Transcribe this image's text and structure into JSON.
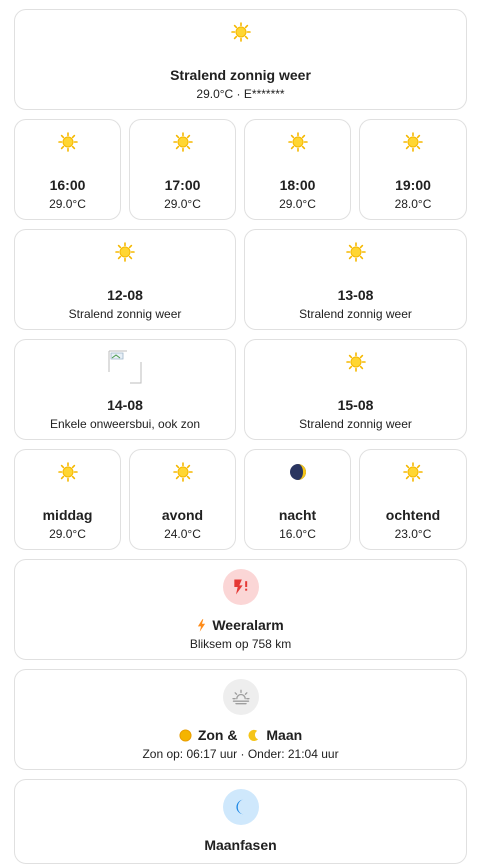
{
  "colors": {
    "sun": "#f5b800",
    "sun_center": "#ffd633",
    "alarm_bg": "#fbd6d6",
    "alarm_fg": "#e53935",
    "sunmoon_bg": "#eeeeee",
    "sunmoon_fg": "#9e9e9e",
    "moon_bg": "#cfe8fc",
    "moon_fg": "#1e88e5"
  },
  "current": {
    "icon": "sun-icon",
    "condition": "Stralend zonnig weer",
    "details": "29.0°C · E*******"
  },
  "hourly": [
    {
      "time": "16:00",
      "temp": "29.0°C",
      "icon": "sun-icon"
    },
    {
      "time": "17:00",
      "temp": "29.0°C",
      "icon": "sun-icon"
    },
    {
      "time": "18:00",
      "temp": "29.0°C",
      "icon": "sun-icon"
    },
    {
      "time": "19:00",
      "temp": "28.0°C",
      "icon": "sun-icon"
    }
  ],
  "daily": [
    {
      "date": "12-08",
      "condition": "Stralend zonnig weer",
      "icon": "sun-icon"
    },
    {
      "date": "13-08",
      "condition": "Stralend zonnig weer",
      "icon": "sun-icon"
    },
    {
      "date": "14-08",
      "condition": "Enkele onweersbui, ook zon",
      "icon": "broken-image-icon"
    },
    {
      "date": "15-08",
      "condition": "Stralend zonnig weer",
      "icon": "sun-icon"
    }
  ],
  "dayparts": [
    {
      "name": "middag",
      "temp": "29.0°C",
      "icon": "sun-icon"
    },
    {
      "name": "avond",
      "temp": "24.0°C",
      "icon": "sun-icon"
    },
    {
      "name": "nacht",
      "temp": "16.0°C",
      "icon": "moon-icon"
    },
    {
      "name": "ochtend",
      "temp": "23.0°C",
      "icon": "sun-icon"
    }
  ],
  "alarm": {
    "icon": "lightning-alert-icon",
    "title": "Weeralarm",
    "text": "Bliksem op 758 km"
  },
  "sunmoon": {
    "icon": "sunrise-icon",
    "title_sun": "Zon &",
    "title_moon": "Maan",
    "text": "Zon op: 06:17 uur ·  Onder: 21:04 uur"
  },
  "moonphase": {
    "icon": "moon-icon",
    "title": "Maanfasen"
  }
}
